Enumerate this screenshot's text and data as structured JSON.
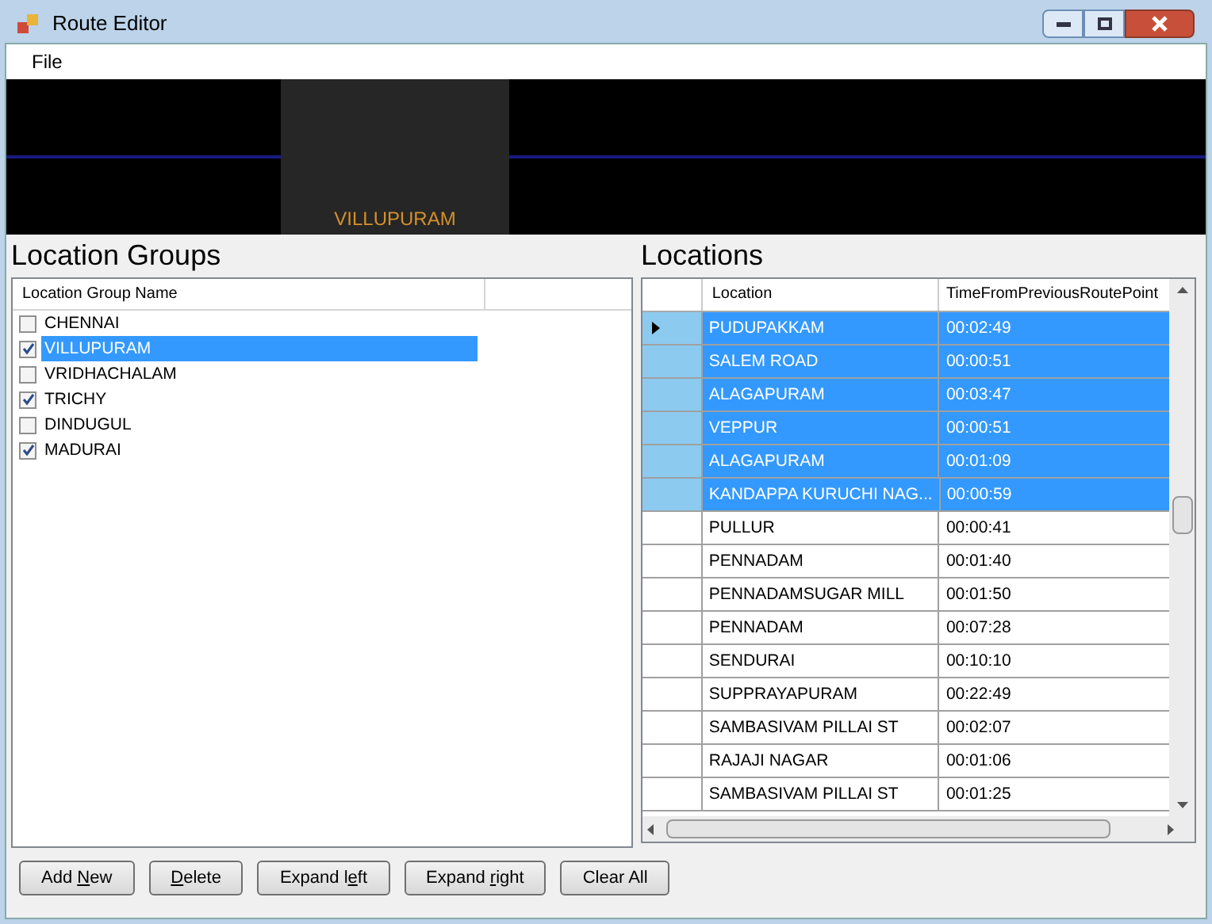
{
  "window": {
    "title": "Route Editor"
  },
  "menu": [
    "File"
  ],
  "banner": {
    "label": "VILLUPURAM"
  },
  "location_groups": {
    "heading": "Location Groups",
    "column": "Location Group Name",
    "items": [
      {
        "name": "CHENNAI",
        "checked": false,
        "selected": false
      },
      {
        "name": "VILLUPURAM",
        "checked": true,
        "selected": true
      },
      {
        "name": "VRIDHACHALAM",
        "checked": false,
        "selected": false
      },
      {
        "name": "TRICHY",
        "checked": true,
        "selected": false
      },
      {
        "name": "DINDUGUL",
        "checked": false,
        "selected": false
      },
      {
        "name": "MADURAI",
        "checked": true,
        "selected": false
      }
    ]
  },
  "locations": {
    "heading": "Locations",
    "columns": [
      "Location",
      "TimeFromPreviousRoutePoint"
    ],
    "rows": [
      {
        "location": "PUDUPAKKAM",
        "time": "00:02:49",
        "selected": true,
        "current": true
      },
      {
        "location": "SALEM ROAD",
        "time": "00:00:51",
        "selected": true,
        "current": false
      },
      {
        "location": "ALAGAPURAM",
        "time": "00:03:47",
        "selected": true,
        "current": false
      },
      {
        "location": "VEPPUR",
        "time": "00:00:51",
        "selected": true,
        "current": false
      },
      {
        "location": "ALAGAPURAM",
        "time": "00:01:09",
        "selected": true,
        "current": false
      },
      {
        "location": "KANDAPPA KURUCHI NAG...",
        "time": "00:00:59",
        "selected": true,
        "current": false
      },
      {
        "location": "PULLUR",
        "time": "00:00:41",
        "selected": false,
        "current": false
      },
      {
        "location": "PENNADAM",
        "time": "00:01:40",
        "selected": false,
        "current": false
      },
      {
        "location": "PENNADAMSUGAR MILL",
        "time": "00:01:50",
        "selected": false,
        "current": false
      },
      {
        "location": "PENNADAM",
        "time": "00:07:28",
        "selected": false,
        "current": false
      },
      {
        "location": "SENDURAI",
        "time": "00:10:10",
        "selected": false,
        "current": false
      },
      {
        "location": "SUPPRAYAPURAM",
        "time": "00:22:49",
        "selected": false,
        "current": false
      },
      {
        "location": "SAMBASIVAM PILLAI ST",
        "time": "00:02:07",
        "selected": false,
        "current": false
      },
      {
        "location": "RAJAJI NAGAR",
        "time": "00:01:06",
        "selected": false,
        "current": false
      },
      {
        "location": "SAMBASIVAM PILLAI ST",
        "time": "00:01:25",
        "selected": false,
        "current": false
      }
    ]
  },
  "buttons": [
    {
      "before": "Add ",
      "key": "N",
      "after": "ew"
    },
    {
      "key": "D",
      "after": "elete"
    },
    {
      "before": "Expand l",
      "key": "e",
      "after": "ft"
    },
    {
      "before": "Expand ",
      "key": "r",
      "after": "ight"
    },
    {
      "before": "Clear All"
    }
  ]
}
